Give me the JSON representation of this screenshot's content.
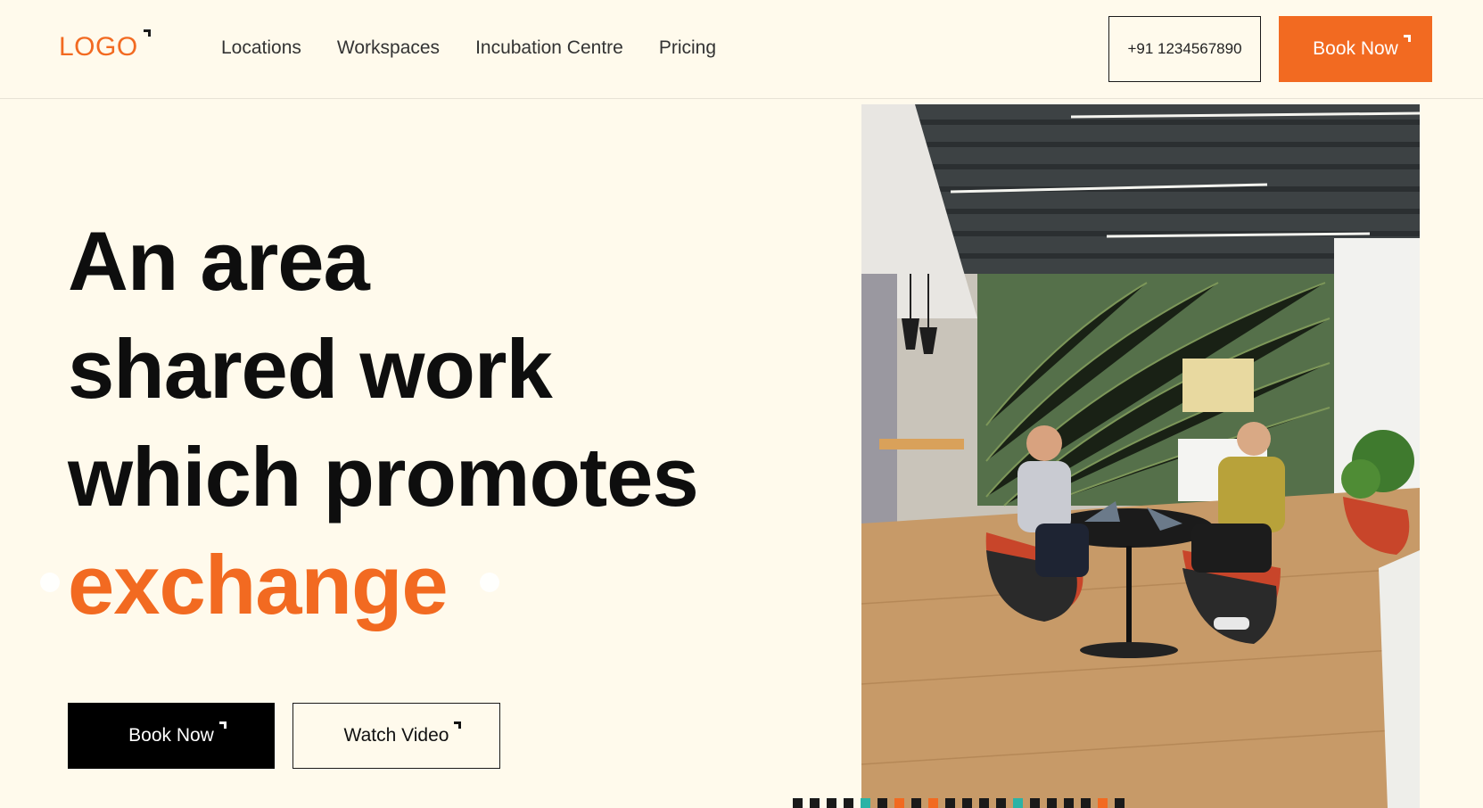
{
  "header": {
    "logo": "LOGO",
    "nav": [
      "Locations",
      "Workspaces",
      "Incubation Centre",
      "Pricing"
    ],
    "phone": "+91 1234567890",
    "book_label": "Book Now"
  },
  "hero": {
    "title_lines": [
      "An area",
      "shared work",
      "which promotes"
    ],
    "accent_word": "exchange",
    "primary_button": "Book Now",
    "secondary_button": "Watch Video"
  },
  "colors": {
    "accent": "#f26a21",
    "background": "#fffaec",
    "teal": "#2bb3a6",
    "dark": "#1a1a1a"
  },
  "pager": {
    "segments": [
      "dark",
      "dark",
      "dark",
      "dark",
      "teal",
      "dark",
      "orange",
      "dark",
      "orange",
      "dark",
      "dark",
      "dark",
      "dark",
      "teal",
      "dark",
      "dark",
      "dark",
      "dark",
      "orange",
      "dark"
    ]
  },
  "photo": {
    "icon": "office-coworking-photo"
  }
}
